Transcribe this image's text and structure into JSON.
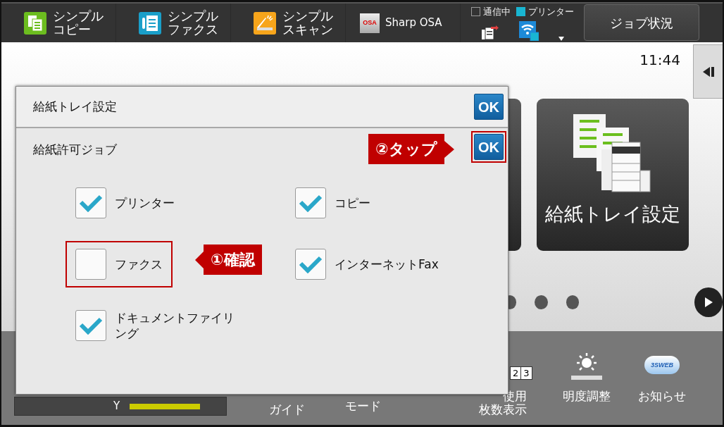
{
  "top_bar": {
    "apps": [
      {
        "kind": "copy",
        "lines": [
          "シンプル",
          "コピー"
        ]
      },
      {
        "kind": "fax",
        "lines": [
          "シンプル",
          "ファクス"
        ]
      },
      {
        "kind": "scan",
        "lines": [
          "シンプル",
          "スキャン"
        ]
      },
      {
        "kind": "osa",
        "logo_text": "OSA",
        "lines": [
          "Sharp OSA"
        ]
      }
    ],
    "indicators": [
      {
        "label": "通信中",
        "lit": false
      },
      {
        "label": "プリンター",
        "lit": true
      }
    ],
    "job_status_button": "ジョブ状況"
  },
  "clock": "11:44",
  "home": {
    "tile_label": "給紙トレイ設定"
  },
  "bottom_bar": {
    "items": [
      {
        "kind": "toner",
        "label": "Y",
        "level": 1
      },
      {
        "kind": "text",
        "lines": [
          "ガイド"
        ]
      },
      {
        "kind": "text",
        "lines": [
          "モード"
        ]
      },
      {
        "kind": "counter",
        "icon_digits": [
          "2",
          "3"
        ],
        "lines": [
          "使用",
          "枚数表示"
        ]
      },
      {
        "kind": "brightness",
        "lines": [
          "明度調整"
        ]
      },
      {
        "kind": "notice",
        "icon_text": "3SWEB",
        "lines": [
          "お知らせ"
        ]
      }
    ]
  },
  "dialog": {
    "title": "給紙トレイ設定",
    "ok": "OK",
    "section": {
      "title": "給紙許可ジョブ",
      "ok": "OK",
      "ok_highlighted": true
    },
    "options": [
      {
        "label": "プリンター",
        "checked": true,
        "highlighted": false
      },
      {
        "label": "コピー",
        "checked": true,
        "highlighted": false
      },
      {
        "label": "ファクス",
        "checked": false,
        "highlighted": true
      },
      {
        "label": "インターネットFax",
        "checked": true,
        "highlighted": false
      },
      {
        "label": "ドキュメントファイリング",
        "checked": true,
        "highlighted": false
      }
    ],
    "callouts": [
      {
        "text": "①確認",
        "kind": "arrow_left"
      },
      {
        "text": "②タップ",
        "kind": "arrow_right"
      }
    ]
  }
}
